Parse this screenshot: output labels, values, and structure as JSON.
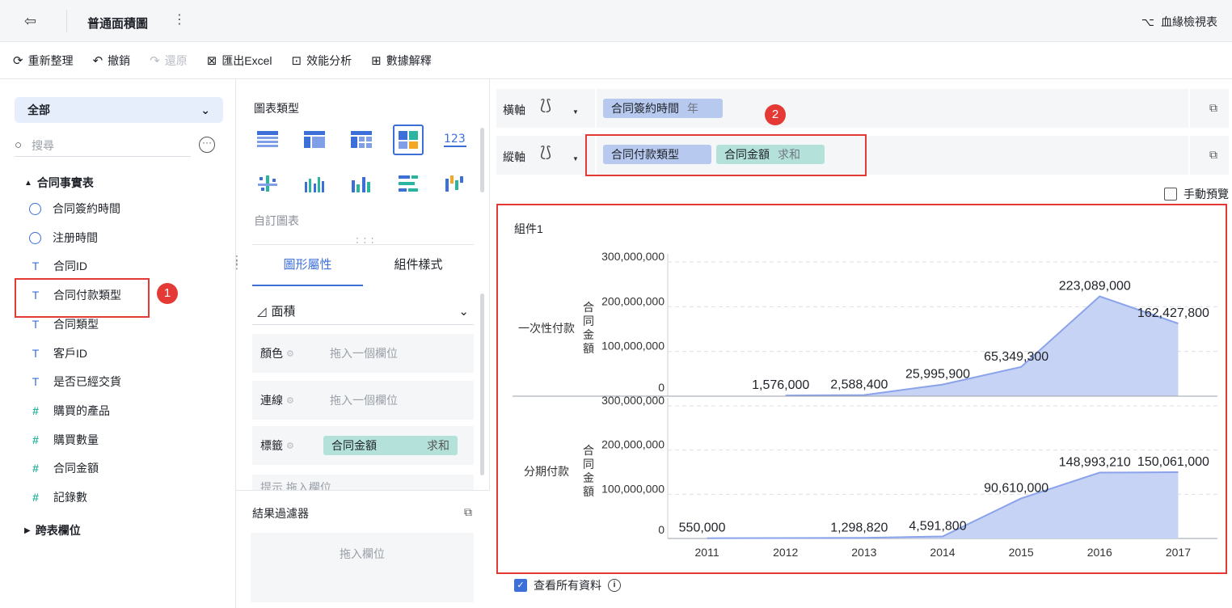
{
  "titlebar": {
    "title": "普通面積圖",
    "lineage_label": "血緣檢視表"
  },
  "toolbar": [
    {
      "label": "重新整理",
      "icon": "refresh-icon"
    },
    {
      "label": "撤銷",
      "icon": "undo-icon"
    },
    {
      "label": "還原",
      "icon": "redo-icon"
    },
    {
      "label": "匯出Excel",
      "icon": "excel-icon"
    },
    {
      "label": "效能分析",
      "icon": "performance-icon"
    },
    {
      "label": "數據解釋",
      "icon": "explain-icon"
    }
  ],
  "left": {
    "scope": "全部",
    "search_placeholder": "搜尋",
    "group": "合同事實表",
    "fields": [
      {
        "label": "合同簽約時間",
        "type": "time"
      },
      {
        "label": "注册時間",
        "type": "time"
      },
      {
        "label": "合同ID",
        "type": "text"
      },
      {
        "label": "合同付款類型",
        "type": "text"
      },
      {
        "label": "合同類型",
        "type": "text"
      },
      {
        "label": "客戶ID",
        "type": "text"
      },
      {
        "label": "是否已經交貨",
        "type": "text"
      },
      {
        "label": "購買的產品",
        "type": "number"
      },
      {
        "label": "購買數量",
        "type": "number"
      },
      {
        "label": "合同金額",
        "type": "number"
      },
      {
        "label": "記錄數",
        "type": "number"
      }
    ],
    "group2": "跨表欄位",
    "badge1": "1"
  },
  "middle": {
    "chart_type_title": "圖表類型",
    "custom_chart": "自訂圖表",
    "tabs": [
      "圖形屬性",
      "組件樣式"
    ],
    "shape": "面積",
    "props": [
      {
        "label": "顏色",
        "placeholder": "拖入一個欄位"
      },
      {
        "label": "連線",
        "placeholder": "拖入一個欄位"
      },
      {
        "label": "標籤",
        "pill": "合同金額",
        "pill_sub": "求和"
      }
    ],
    "partial_row": "提示 拖入欄位",
    "result_filter": "結果過濾器",
    "result_filter_placeholder": "拖入欄位"
  },
  "axes": {
    "x_label": "橫軸",
    "x_field": "合同簽約時間",
    "x_field_sub": "年",
    "y_label": "縱軸",
    "y_field1": "合同付款類型",
    "y_field2": "合同金額",
    "y_field2_sub": "求和",
    "badge2": "2"
  },
  "manual_preview": "手動預覽",
  "view_all": "查看所有資料",
  "colors": {
    "area_fill": "#c7d3f4",
    "area_line": "#8aa3ea",
    "accent": "#3c6fd8",
    "highlight": "#e53935"
  },
  "chart_data": {
    "type": "area",
    "title": "組件1",
    "categories": [
      "2011",
      "2012",
      "2013",
      "2014",
      "2015",
      "2016",
      "2017"
    ],
    "ylabel": "合同金額",
    "ylim": [
      0,
      300000000
    ],
    "yticks": [
      "0",
      "100,000,000",
      "200,000,000",
      "300,000,000"
    ],
    "panels": [
      {
        "name": "一次性付款",
        "points": [
          [
            1,
            1576000
          ],
          [
            2,
            2588400
          ],
          [
            3,
            25995900
          ],
          [
            4,
            65349300
          ],
          [
            5,
            223089000
          ],
          [
            6,
            162427800
          ]
        ],
        "labels": [
          "1,576,000",
          "2,588,400",
          "25,995,900",
          "65,349,300",
          "223,089,000",
          "162,427,800"
        ]
      },
      {
        "name": "分期付款",
        "points": [
          [
            0,
            550000
          ],
          [
            2,
            1298820
          ],
          [
            3,
            4591800
          ],
          [
            4,
            90610000
          ],
          [
            5,
            148993210
          ],
          [
            6,
            150061000
          ]
        ],
        "labels": [
          "550,000",
          "1,298,820",
          "4,591,800",
          "90,610,000",
          "148,993,210",
          "150,061,000"
        ]
      }
    ]
  }
}
